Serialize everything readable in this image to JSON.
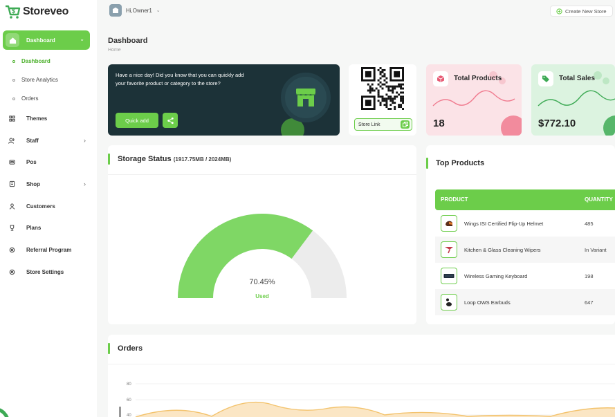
{
  "brand": {
    "name": "Storeveo",
    "color": "#6ccd4a"
  },
  "sidebar": {
    "active": {
      "label": "Dashboard",
      "icon": "home-icon"
    },
    "subitems": [
      {
        "label": "Dashboard",
        "active": true
      },
      {
        "label": "Store Analytics",
        "active": false
      },
      {
        "label": "Orders",
        "active": false
      }
    ],
    "items": [
      {
        "label": "Themes",
        "icon": "grid-icon",
        "has_children": false
      },
      {
        "label": "Staff",
        "icon": "users-icon",
        "has_children": true
      },
      {
        "label": "Pos",
        "icon": "pos-icon",
        "has_children": false
      },
      {
        "label": "Shop",
        "icon": "shop-icon",
        "has_children": true
      },
      {
        "label": "Customers",
        "icon": "user-icon",
        "has_children": false
      },
      {
        "label": "Plans",
        "icon": "trophy-icon",
        "has_children": false
      },
      {
        "label": "Referral Program",
        "icon": "gear-icon",
        "has_children": false
      },
      {
        "label": "Store Settings",
        "icon": "gear-icon",
        "has_children": false
      }
    ]
  },
  "topbar": {
    "user": "Hi,Owner1",
    "create_store": "Create New Store"
  },
  "page": {
    "title": "Dashboard",
    "breadcrumb": "Home"
  },
  "promo": {
    "text": "Have a nice day! Did you know that you can quickly add your favorite product or category to the store?",
    "quick_add": "Quick add"
  },
  "qr": {
    "store_link": "Store Link"
  },
  "stats": [
    {
      "title": "Total Products",
      "value": "18",
      "bg": "#fbe3e7"
    },
    {
      "title": "Total Sales",
      "value": "$772.10",
      "bg": "#dcf3e0"
    }
  ],
  "storage": {
    "title": "Storage Status",
    "detail": "(1917.75MB / 2024MB)",
    "percent_label": "70.45%",
    "percent": 70.45,
    "used_label": "Used"
  },
  "top_products": {
    "title": "Top Products",
    "columns": [
      "PRODUCT",
      "QUANTITY"
    ],
    "rows": [
      {
        "name": "Wings ISI Certified Flip-Up Helmet",
        "qty": "485"
      },
      {
        "name": "Kitchen & Glass Cleaning Wipers",
        "qty": "In Variant"
      },
      {
        "name": "Wireless Gaming Keyboard",
        "qty": "198"
      },
      {
        "name": "Loop OWS Earbuds",
        "qty": "647"
      }
    ]
  },
  "orders": {
    "title": "Orders",
    "yticks": [
      "80",
      "60",
      "40"
    ]
  }
}
